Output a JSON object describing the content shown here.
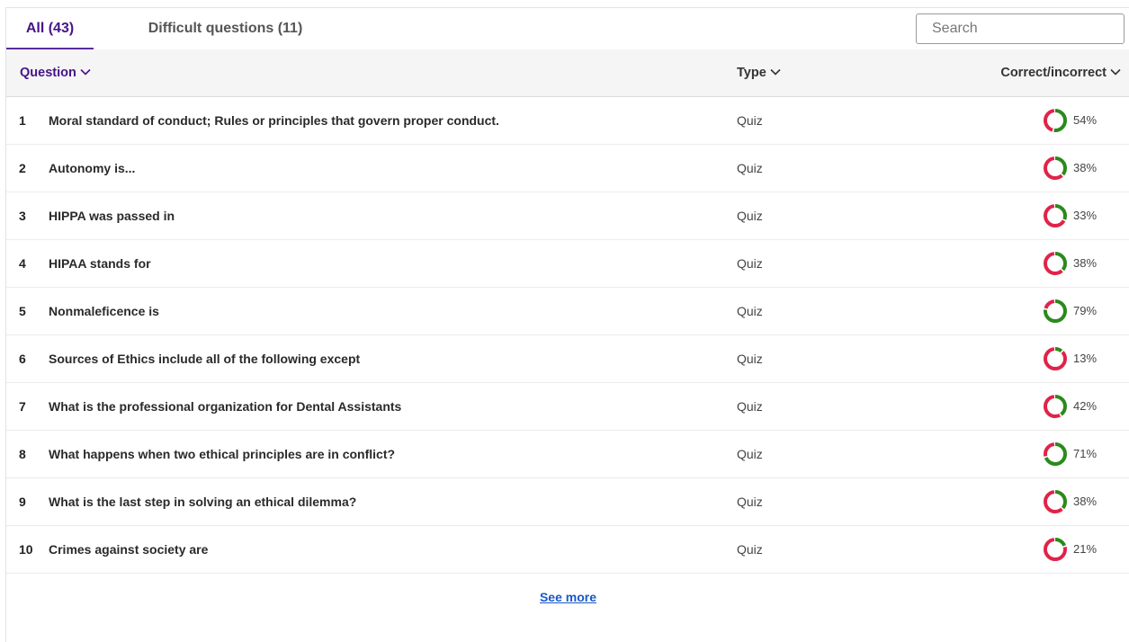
{
  "tabs": [
    {
      "label": "All (43)",
      "active": true
    },
    {
      "label": "Difficult questions (11)",
      "active": false
    }
  ],
  "search": {
    "placeholder": "Search",
    "value": ""
  },
  "columns": {
    "question": "Question",
    "type": "Type",
    "correct": "Correct/incorrect"
  },
  "colors": {
    "accent": "#46148a",
    "correct": "#2a8a1c",
    "incorrect": "#e0234a",
    "link": "#1a57c7"
  },
  "icons": {
    "sort": "chevron-down-icon",
    "result": "donut-chart-icon"
  },
  "rows": [
    {
      "num": "1",
      "question": "Moral standard of conduct; Rules or principles that govern proper conduct.",
      "type": "Quiz",
      "percent_label": "54%",
      "percent": 54
    },
    {
      "num": "2",
      "question": "Autonomy is...",
      "type": "Quiz",
      "percent_label": "38%",
      "percent": 38
    },
    {
      "num": "3",
      "question": "HIPPA was passed in",
      "type": "Quiz",
      "percent_label": "33%",
      "percent": 33
    },
    {
      "num": "4",
      "question": "HIPAA stands for",
      "type": "Quiz",
      "percent_label": "38%",
      "percent": 38
    },
    {
      "num": "5",
      "question": "Nonmaleficence is",
      "type": "Quiz",
      "percent_label": "79%",
      "percent": 79
    },
    {
      "num": "6",
      "question": "Sources of Ethics include all of the following except",
      "type": "Quiz",
      "percent_label": "13%",
      "percent": 13
    },
    {
      "num": "7",
      "question": "What is the professional organization for Dental Assistants",
      "type": "Quiz",
      "percent_label": "42%",
      "percent": 42
    },
    {
      "num": "8",
      "question": "What happens when two ethical principles are in conflict?",
      "type": "Quiz",
      "percent_label": "71%",
      "percent": 71
    },
    {
      "num": "9",
      "question": "What is the last step in solving an ethical dilemma?",
      "type": "Quiz",
      "percent_label": "38%",
      "percent": 38
    },
    {
      "num": "10",
      "question": "Crimes against society are",
      "type": "Quiz",
      "percent_label": "21%",
      "percent": 21
    }
  ],
  "footer": {
    "see_more": "See more"
  }
}
